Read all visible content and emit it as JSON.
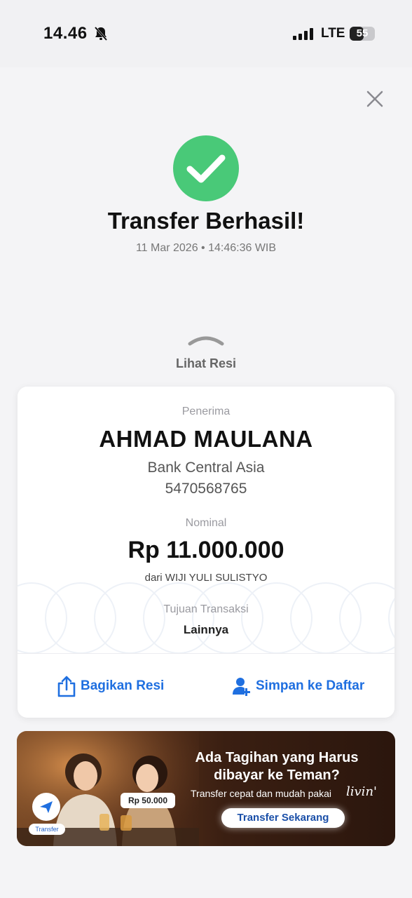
{
  "status_bar": {
    "time": "14.46",
    "network": "LTE",
    "battery": "55",
    "battery_level": 0.55
  },
  "header": {
    "close_icon": "close-icon",
    "success_icon": "check-icon",
    "title": "Transfer Berhasil!",
    "datetime": "11 Mar 2026 • 14:46:36 WIB"
  },
  "receipt_toggle": {
    "label": "Lihat Resi"
  },
  "receipt": {
    "recipient_label": "Penerima",
    "recipient_name": "AHMAD MAULANA",
    "bank": "Bank Central Asia",
    "account_number": "5470568765",
    "amount_label": "Nominal",
    "amount": "Rp 11.000.000",
    "sender": "dari WIJI YULI SULISTYO",
    "purpose_label": "Tujuan Transaksi",
    "purpose": "Lainnya"
  },
  "actions": {
    "share_label": "Bagikan Resi",
    "save_label": "Simpan ke Daftar"
  },
  "banner": {
    "title_line1": "Ada Tagihan yang Harus",
    "title_line2": "dibayar ke Teman?",
    "subtitle": "Transfer cepat dan mudah pakai",
    "logo": "livin'",
    "cta": "Transfer Sekarang",
    "price_tag": "Rp 50.000",
    "transfer_badge": "Transfer"
  },
  "colors": {
    "success": "#49c978",
    "accent": "#1f6fe0"
  }
}
